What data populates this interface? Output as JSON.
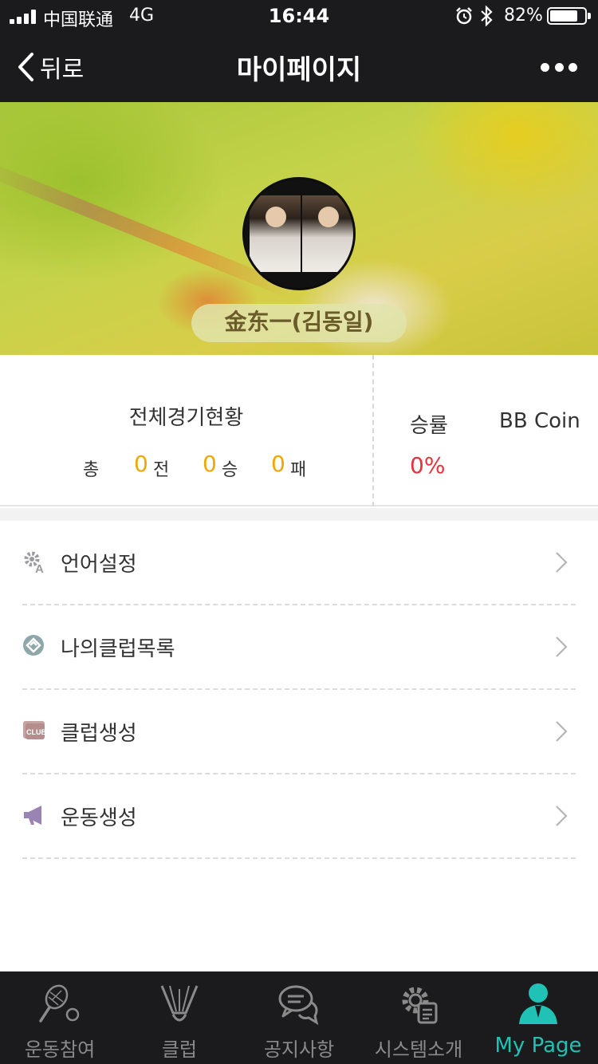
{
  "status_bar": {
    "carrier": "中国联通",
    "network": "4G",
    "time": "16:44",
    "battery_percent": "82%",
    "battery_level": 0.82
  },
  "nav": {
    "back_label": "뒤로",
    "title": "마이페이지"
  },
  "profile": {
    "name": "金东一(김동일)"
  },
  "stats": {
    "overall_title": "전체경기현황",
    "total_prefix": "총",
    "games_count": "0",
    "games_unit": "전",
    "wins_count": "0",
    "wins_unit": "승",
    "losses_count": "0",
    "losses_unit": "패",
    "win_rate_label": "승률",
    "win_rate_value": "0%",
    "coin_label": "BB Coin"
  },
  "menu": [
    {
      "label": "언어설정",
      "icon": "language-settings-icon"
    },
    {
      "label": "나의클럽목록",
      "icon": "club-list-icon"
    },
    {
      "label": "클럽생성",
      "icon": "club-create-icon"
    },
    {
      "label": "운동생성",
      "icon": "megaphone-icon"
    }
  ],
  "tabs": [
    {
      "label": "운동참여",
      "icon": "badminton-icon"
    },
    {
      "label": "클럽",
      "icon": "shuttlecock-icon"
    },
    {
      "label": "공지사항",
      "icon": "chat-bubbles-icon"
    },
    {
      "label": "시스템소개",
      "icon": "gear-document-icon"
    },
    {
      "label": "My Page",
      "icon": "user-icon",
      "active": true
    }
  ],
  "colors": {
    "bar_background": "#1b1b1d",
    "accent": "#1fc2b4",
    "record_number": "#f0a800",
    "win_rate": "#e8323c"
  }
}
